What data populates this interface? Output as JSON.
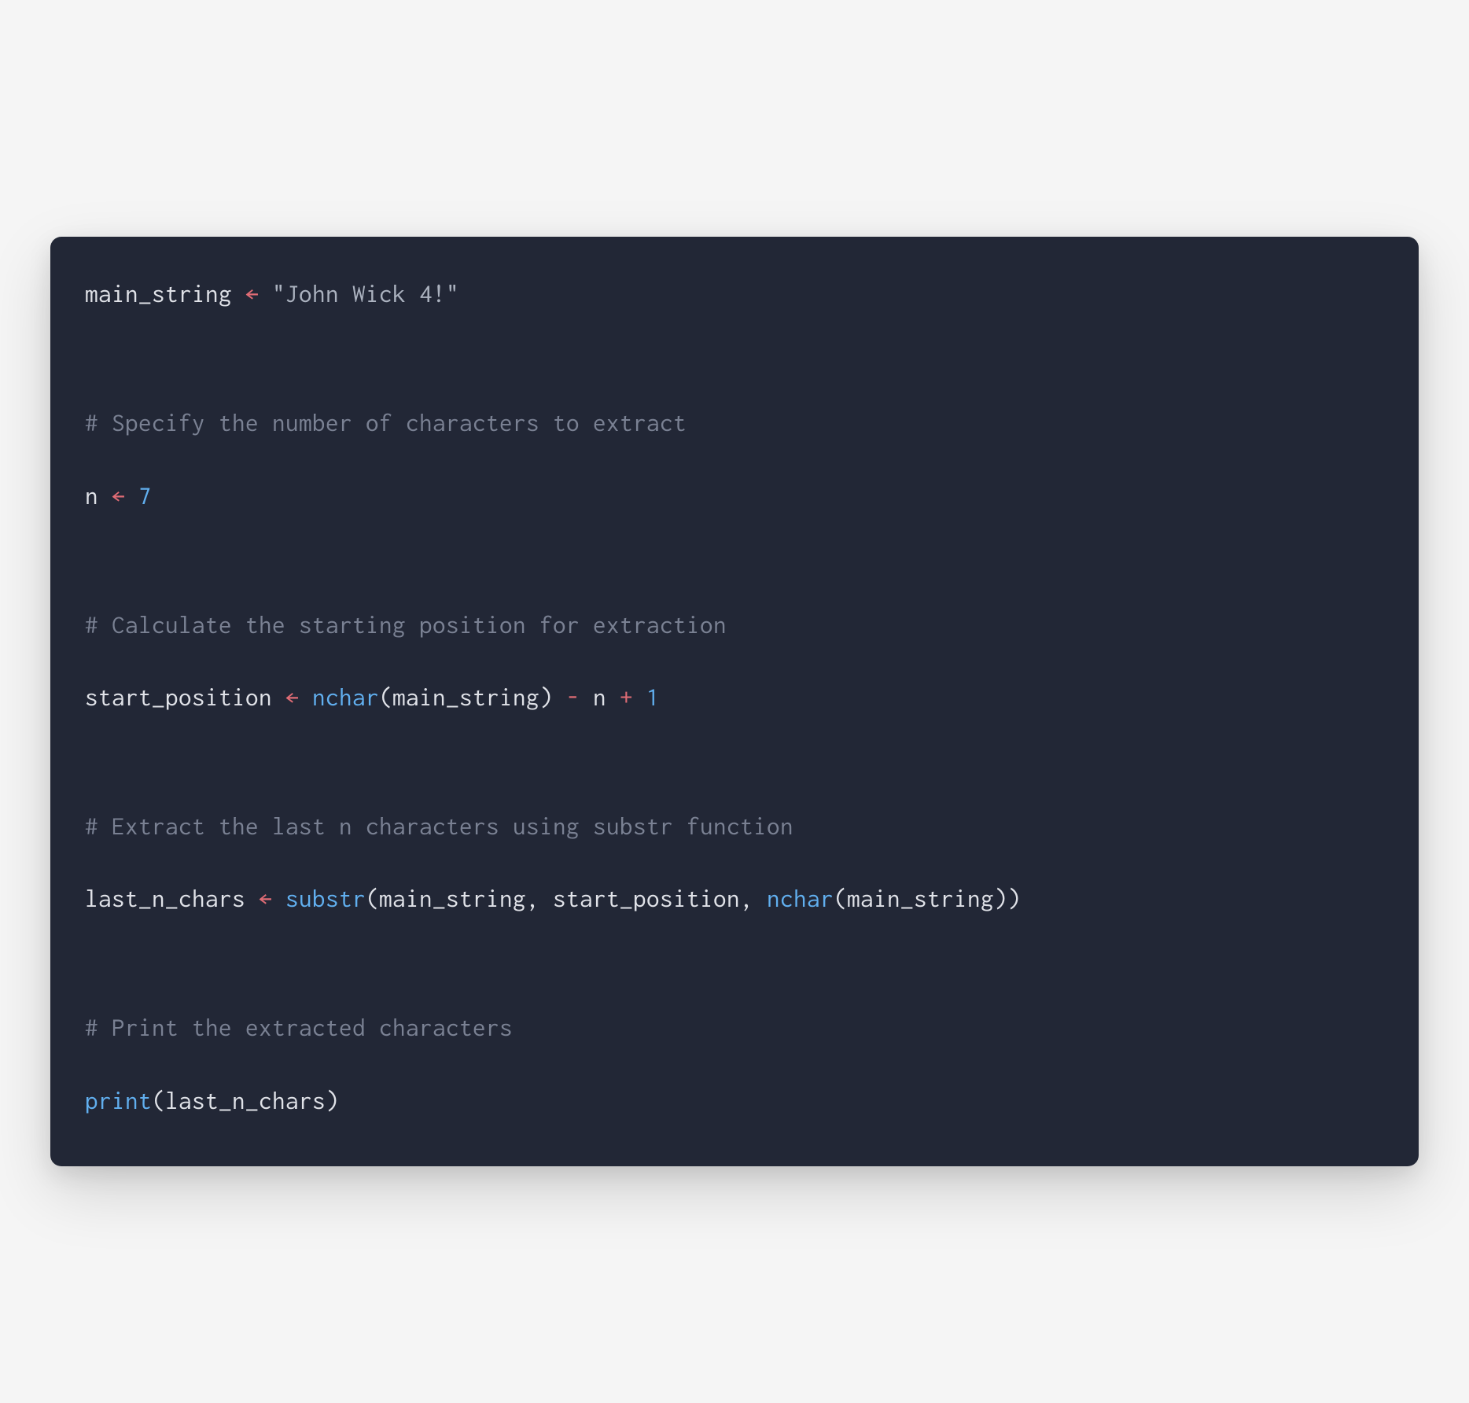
{
  "code": {
    "line1": {
      "ident": "main_string",
      "arrow": " ← ",
      "string": "\"John Wick 4!\""
    },
    "comment1": "# Specify the number of characters to extract",
    "line2": {
      "ident": "n",
      "arrow": " ← ",
      "number": "7"
    },
    "comment2": "# Calculate the starting position for extraction",
    "line3": {
      "ident": "start_position",
      "arrow": " ← ",
      "func": "nchar",
      "paren_open": "(",
      "arg1": "main_string",
      "paren_close": ")",
      "op_minus": " - ",
      "var_n": "n",
      "op_plus": " + ",
      "number_1": "1"
    },
    "comment3": "# Extract the last n characters using substr function",
    "line4": {
      "ident": "last_n_chars",
      "arrow": " ← ",
      "func1": "substr",
      "paren_open1": "(",
      "arg1": "main_string",
      "comma1": ", ",
      "arg2": "start_position",
      "comma2": ", ",
      "func2": "nchar",
      "paren_open2": "(",
      "arg3": "main_string",
      "paren_close2": ")",
      "paren_close1": ")"
    },
    "comment4": "# Print the extracted characters",
    "line5": {
      "func": "print",
      "paren_open": "(",
      "arg": "last_n_chars",
      "paren_close": ")"
    }
  }
}
